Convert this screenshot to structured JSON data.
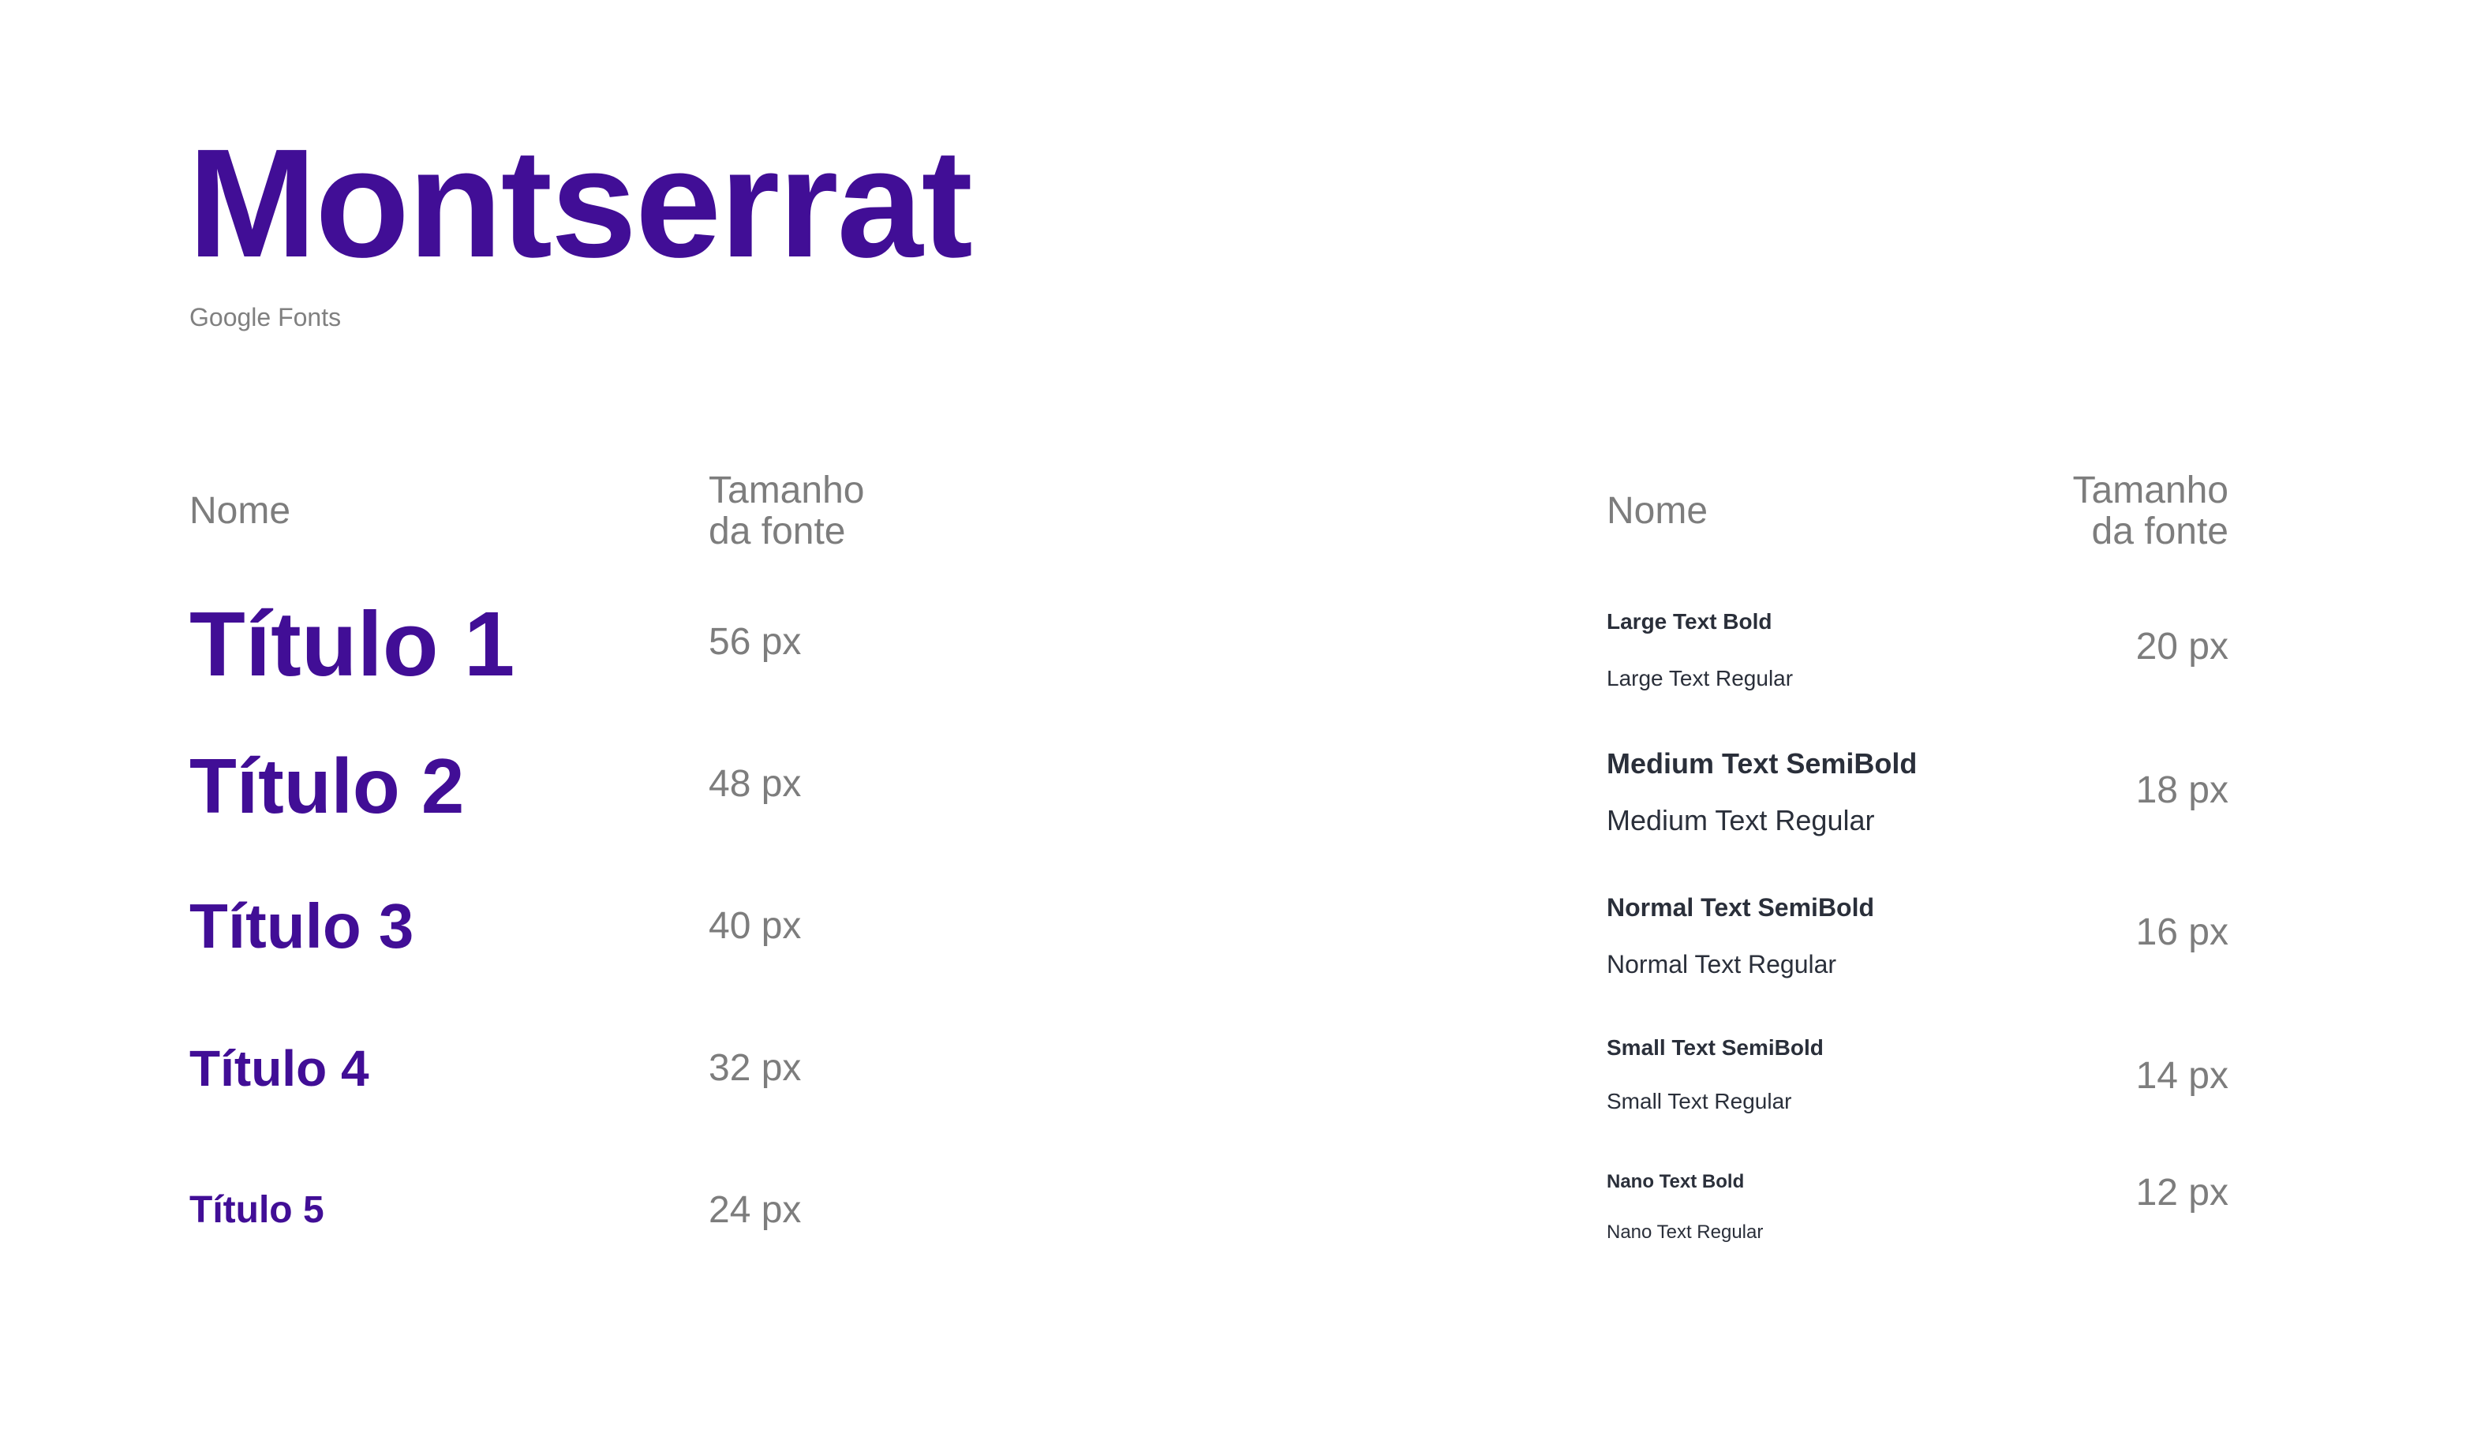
{
  "header": {
    "title": "Montserrat",
    "subtitle": "Google Fonts"
  },
  "left_table": {
    "col_name": "Nome",
    "col_size_line1": "Tamanho",
    "col_size_line2": "da fonte",
    "rows": [
      {
        "name": "Título 1",
        "size": "56 px"
      },
      {
        "name": "Título 2",
        "size": "48 px"
      },
      {
        "name": "Título 3",
        "size": "40 px"
      },
      {
        "name": "Título 4",
        "size": "32 px"
      },
      {
        "name": "Título 5",
        "size": "24 px"
      }
    ]
  },
  "right_table": {
    "col_name": "Nome",
    "col_size_line1": "Tamanho",
    "col_size_line2": "da fonte",
    "rows": [
      {
        "strong": "Large Text Bold",
        "regular": "Large Text Regular",
        "size": "20 px"
      },
      {
        "strong": "Medium Text SemiBold",
        "regular": "Medium Text Regular",
        "size": "18 px"
      },
      {
        "strong": "Normal Text SemiBold",
        "regular": "Normal Text Regular",
        "size": "16 px"
      },
      {
        "strong": "Small Text SemiBold",
        "regular": "Small Text Regular",
        "size": "14 px"
      },
      {
        "strong": "Nano Text Bold",
        "regular": "Nano Text Regular",
        "size": "12 px"
      }
    ]
  },
  "colors": {
    "brand": "#410e96",
    "muted": "#7d7d7d",
    "dark": "#2a2f3a"
  }
}
